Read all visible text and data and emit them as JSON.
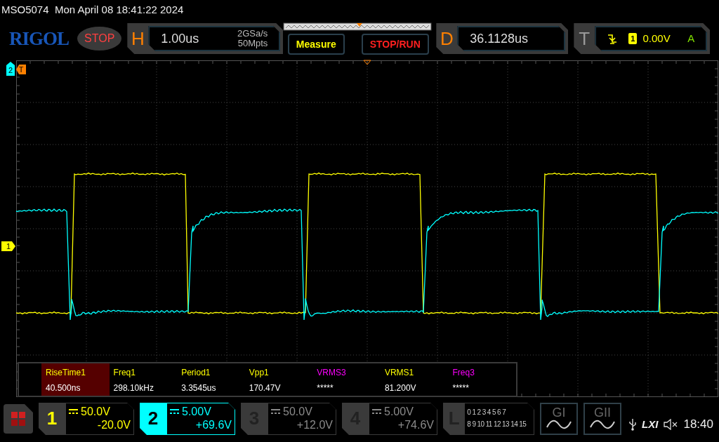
{
  "status_line": {
    "model": "MSO5074",
    "datetime": "Mon April 08 18:41:22 2024"
  },
  "toolbar": {
    "logo": "RIGOL",
    "run_state": "STOP",
    "horizontal": {
      "label": "H",
      "timebase": "1.00us",
      "sample_rate": "2GSa/s",
      "memory_depth": "50Mpts"
    },
    "buttons": [
      {
        "label": "Measure",
        "kind": "measure"
      },
      {
        "label": "STOP/RUN",
        "kind": "run"
      }
    ],
    "delay": {
      "label": "D",
      "value": "36.1128us"
    },
    "trigger": {
      "label": "T",
      "source": "1",
      "trigger_level": "0.00V",
      "mode": "A"
    }
  },
  "markers": [
    {
      "label": "2",
      "kind": "channel",
      "color": "#00ffff"
    },
    {
      "label": "T",
      "kind": "trigger",
      "color": "#ff8000"
    },
    {
      "label": "1",
      "kind": "channel",
      "color": "#ffff00"
    }
  ],
  "measurements": [
    {
      "label": "RiseTime1",
      "value": "40.500ns",
      "color": "#ffff00",
      "selected": true
    },
    {
      "label": "Freq1",
      "value": "298.10kHz",
      "color": "#ffff00",
      "selected": false
    },
    {
      "label": "Period1",
      "value": "3.3545us",
      "color": "#ffff00",
      "selected": false
    },
    {
      "label": "Vpp1",
      "value": "170.47V",
      "color": "#ffff00",
      "selected": false
    },
    {
      "label": "VRMS3",
      "value": "*****",
      "color": "#ff00ff",
      "selected": false
    },
    {
      "label": "VRMS1",
      "value": "81.200V",
      "color": "#ffff00",
      "selected": false
    },
    {
      "label": "Freq3",
      "value": "*****",
      "color": "#ff00ff",
      "selected": false
    }
  ],
  "channels": [
    {
      "number": "1",
      "scale": "50.0V",
      "offset": "-20.0V",
      "on": true,
      "selected": false,
      "color": "#ffff00"
    },
    {
      "number": "2",
      "scale": "5.00V",
      "offset": "+69.6V",
      "on": true,
      "selected": true,
      "color": "#00ffff"
    },
    {
      "number": "3",
      "scale": "50.0V",
      "offset": "+12.0V",
      "on": false,
      "selected": false
    },
    {
      "number": "4",
      "scale": "5.00V",
      "offset": "+74.6V",
      "on": false,
      "selected": false
    }
  ],
  "logic": {
    "label": "L",
    "rows": [
      "0 1 2 3 4 5 6 7",
      "8 9 10 11 12 13 14 15"
    ]
  },
  "generators": [
    {
      "label": "GI"
    },
    {
      "label": "GII"
    }
  ],
  "status_icons": {
    "lxi": "LXI",
    "time": "18:40"
  }
}
